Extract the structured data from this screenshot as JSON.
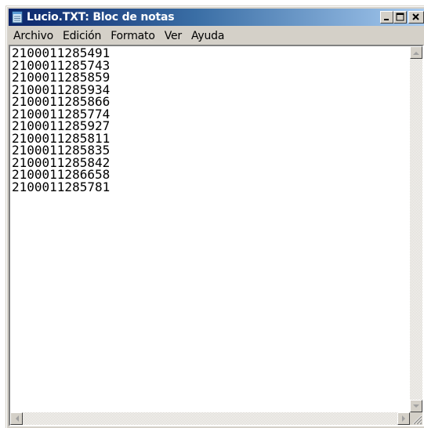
{
  "window": {
    "title": "Lucio.TXT: Bloc de notas",
    "icon": "notepad-icon",
    "controls": [
      "minimize-icon",
      "maximize-icon",
      "close-icon"
    ]
  },
  "menubar": {
    "items": [
      {
        "label": "Archivo"
      },
      {
        "label": "Edición"
      },
      {
        "label": "Formato"
      },
      {
        "label": "Ver"
      },
      {
        "label": "Ayuda"
      }
    ]
  },
  "document": {
    "lines": [
      "2100011285491",
      "2100011285743",
      "2100011285859",
      "2100011285934",
      "2100011285866",
      "2100011285774",
      "2100011285927",
      "2100011285811",
      "2100011285835",
      "2100011285842",
      "2100011286658",
      "2100011285781"
    ]
  },
  "colors": {
    "titlebar_start": "#0a246a",
    "titlebar_end": "#a6caf0",
    "chrome": "#d4d0c8"
  }
}
